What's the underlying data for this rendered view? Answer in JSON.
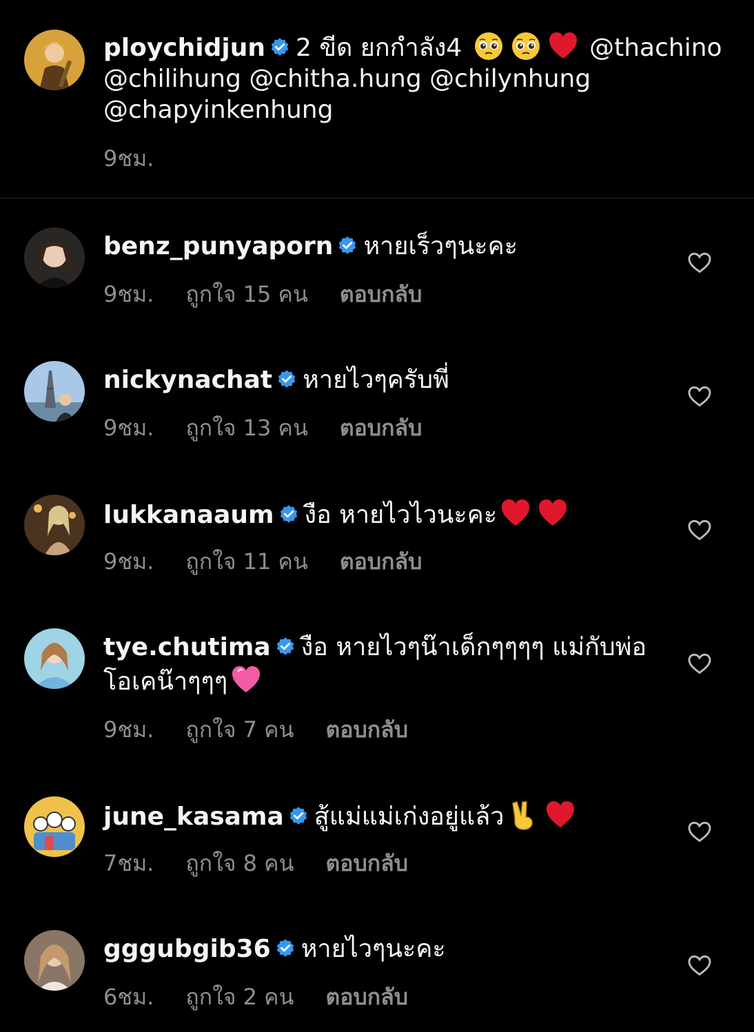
{
  "colors": {
    "background": "#000000",
    "text": "#f5f5f5",
    "secondary_text": "#8e8e8e",
    "verified_blue": "#3797f0",
    "heart_red": "#e0182b",
    "divider": "#262626"
  },
  "caption": {
    "username": "ploychidjun",
    "text_part1": "2 ขีด ยกกำลัง4",
    "emoji": [
      "pleading-face-emoji",
      "pleading-face-emoji",
      "red-heart-emoji"
    ],
    "mentions_line1": "@thachino",
    "mentions_line2": "@chilihung @chitha.hung @chilynhung",
    "mentions_line3": "@chapyinkenhung",
    "time": "9ชม."
  },
  "comments": [
    {
      "username": "benz_punyaporn",
      "text": "หายเร็วๆนะคะ",
      "time": "9ชม.",
      "likes": "ถูกใจ 15 คน",
      "reply": "ตอบกลับ",
      "emoji": []
    },
    {
      "username": "nickynachat",
      "text": "หายไวๆครับพี่",
      "time": "9ชม.",
      "likes": "ถูกใจ 13 คน",
      "reply": "ตอบกลับ",
      "emoji": []
    },
    {
      "username": "lukkanaaum",
      "text": "งือ หายไวไวนะคะ",
      "time": "9ชม.",
      "likes": "ถูกใจ 11 คน",
      "reply": "ตอบกลับ",
      "emoji": [
        "red-heart-emoji",
        "red-heart-emoji"
      ]
    },
    {
      "username": "tye.chutima",
      "text": "งือ หายไวๆน๊าเด็กๆๆๆๆ แม่กับพ่อโอเคน๊าๆๆๆ",
      "time": "9ชม.",
      "likes": "ถูกใจ 7 คน",
      "reply": "ตอบกลับ",
      "emoji": [
        "pink-heart-emoji"
      ]
    },
    {
      "username": "june_kasama",
      "text": "สู้แม่แม่เก่งอยู่แล้ว",
      "time": "7ชม.",
      "likes": "ถูกใจ 8 คน",
      "reply": "ตอบกลับ",
      "emoji": [
        "victory-hand-emoji",
        "red-heart-emoji"
      ]
    },
    {
      "username": "gggubgib36",
      "text": "หายไวๆนะคะ",
      "time": "6ชม.",
      "likes": "ถูกใจ 2 คน",
      "reply": "ตอบกลับ",
      "emoji": []
    }
  ]
}
